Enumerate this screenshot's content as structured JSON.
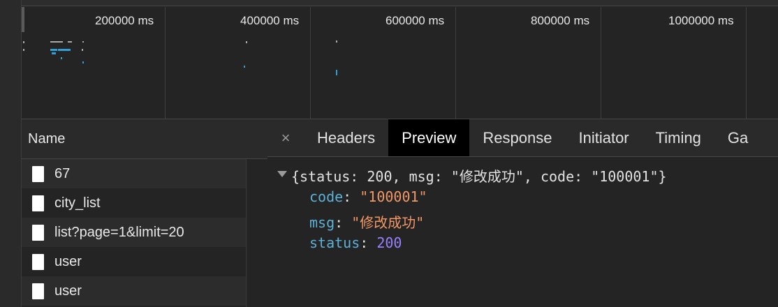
{
  "timeline": {
    "ticks": [
      "200000 ms",
      "400000 ms",
      "600000 ms",
      "800000 ms",
      "1000000 ms"
    ]
  },
  "name_panel": {
    "header": "Name",
    "rows": [
      {
        "label": "67"
      },
      {
        "label": "city_list"
      },
      {
        "label": "list?page=1&limit=20"
      },
      {
        "label": "user"
      },
      {
        "label": "user"
      }
    ]
  },
  "detail": {
    "close_glyph": "×",
    "tabs": [
      "Headers",
      "Preview",
      "Response",
      "Initiator",
      "Timing",
      "Ga"
    ],
    "active_tab": "Preview",
    "preview": {
      "summary": "{status: 200, msg: \"修改成功\", code: \"100001\"}",
      "fields": [
        {
          "key": "code",
          "value": "\"100001\"",
          "kind": "string"
        },
        {
          "key": "msg",
          "value": "\"修改成功\"",
          "kind": "string"
        },
        {
          "key": "status",
          "value": "200",
          "kind": "number"
        }
      ]
    }
  },
  "colors": {
    "key": "#5db0d7",
    "string": "#f29766",
    "number": "#9980ff",
    "waterfall": "#2f9fd6"
  }
}
